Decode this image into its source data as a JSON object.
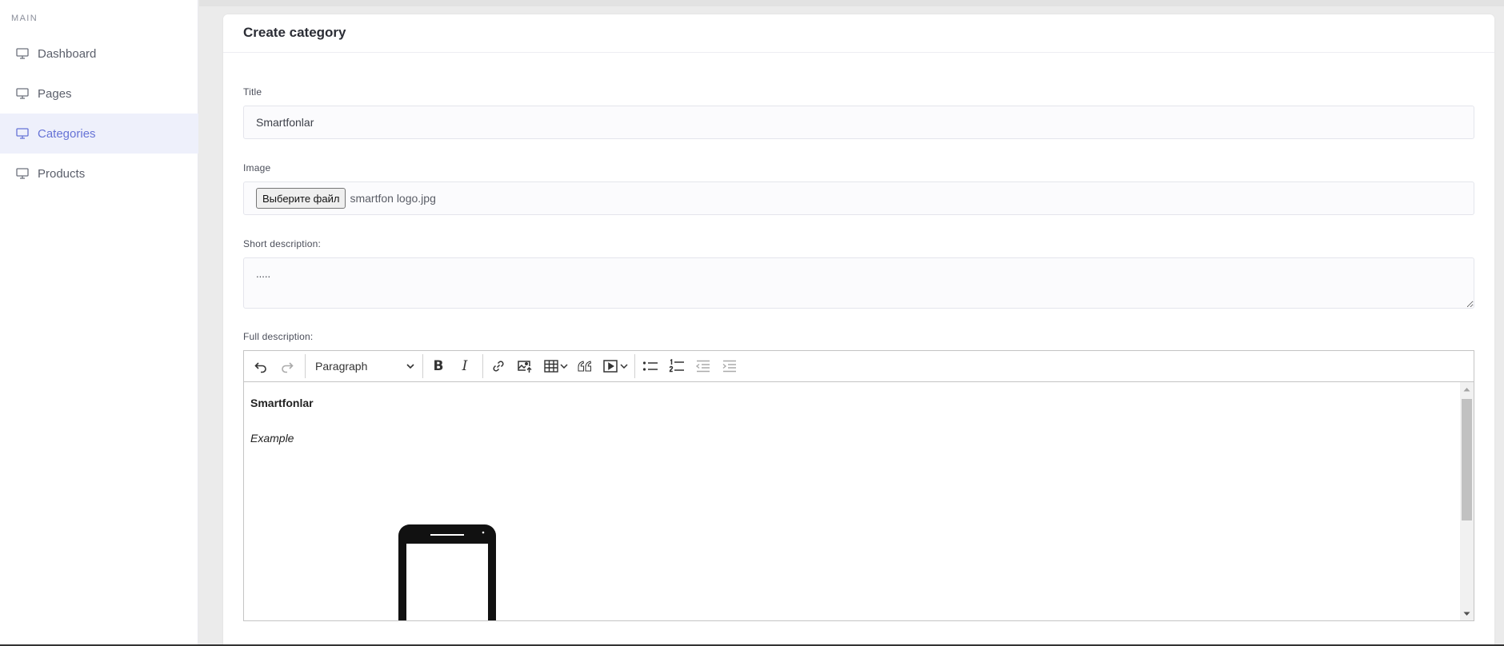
{
  "sidebar": {
    "heading": "MAIN",
    "items": [
      {
        "label": "Dashboard",
        "icon": "monitor-icon",
        "active": false
      },
      {
        "label": "Pages",
        "icon": "monitor-icon",
        "active": false
      },
      {
        "label": "Categories",
        "icon": "monitor-icon",
        "active": true
      },
      {
        "label": "Products",
        "icon": "monitor-icon",
        "active": false
      }
    ]
  },
  "form": {
    "title": "Create category",
    "title_label": "Title",
    "title_value": "Smartfonlar",
    "image_label": "Image",
    "file_button": "Выберите файл",
    "file_name": "smartfon logo.jpg",
    "short_description_label": "Short description:",
    "short_description_value": ".....",
    "full_description_label": "Full description:"
  },
  "editor": {
    "heading_select": "Paragraph",
    "toolbar_icons": [
      "undo-icon",
      "redo-icon",
      "bold-icon",
      "italic-icon",
      "link-icon",
      "insert-image-icon",
      "table-icon",
      "blockquote-icon",
      "media-embed-icon",
      "bulleted-list-icon",
      "numbered-list-icon",
      "outdent-icon",
      "indent-icon"
    ],
    "content": {
      "heading": "Smartfonlar",
      "example": "Example",
      "image": "smartphone-image"
    }
  },
  "colors": {
    "accent": "#6673d6",
    "active_bg": "#eef0fb",
    "page_bg": "#ebebeb"
  }
}
